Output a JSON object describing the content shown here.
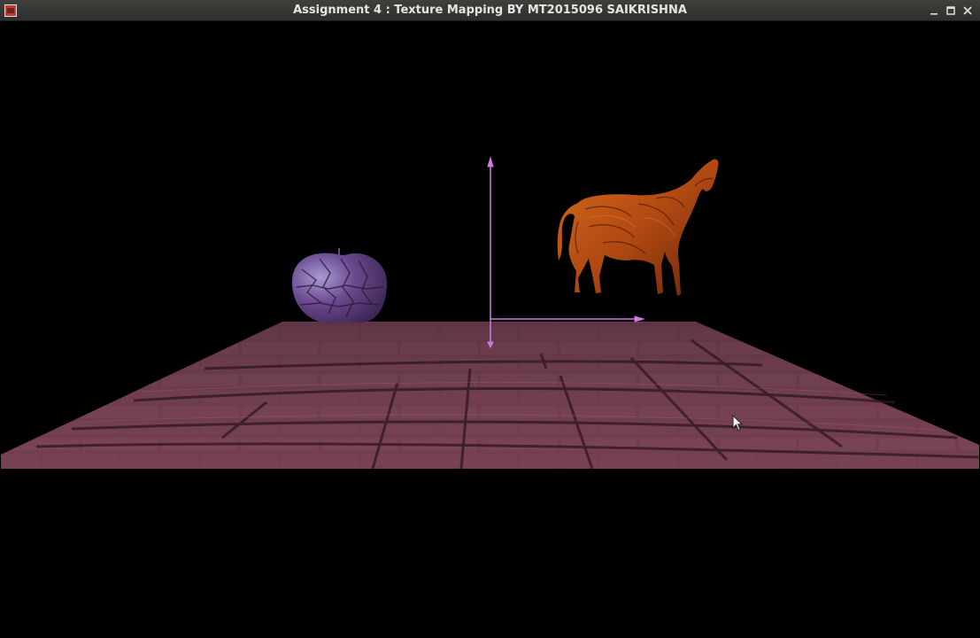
{
  "window": {
    "title": "Assignment 4 : Texture Mapping BY MT2015096 SAIKRISHNA",
    "icons": {
      "app": "app-icon",
      "minimize": "minimize-icon",
      "maximize": "maximize-icon",
      "close": "close-icon"
    }
  },
  "scene": {
    "background_color": "#000000",
    "objects": [
      "floor",
      "apple",
      "horse",
      "axes"
    ],
    "colors": {
      "floor": "#6b3a4c",
      "apple": "#6a4a8e",
      "horse": "#b14a12",
      "axes": "#d07adf"
    }
  }
}
